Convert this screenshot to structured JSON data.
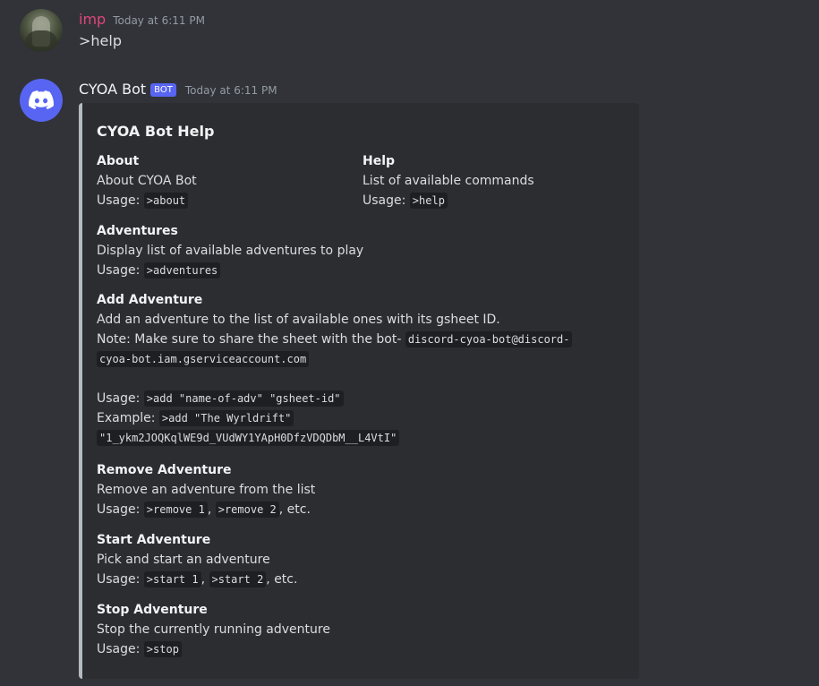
{
  "messages": {
    "user": {
      "username": "imp",
      "timestamp": "Today at 6:11 PM",
      "text": ">help"
    },
    "bot": {
      "username": "CYOA Bot",
      "tag": "BOT",
      "timestamp": "Today at 6:11 PM"
    }
  },
  "embed": {
    "title": "CYOA Bot Help",
    "accent_color": "#b5bac1",
    "fields": {
      "about": {
        "name": "About",
        "desc": "About CYOA Bot",
        "usage_label": "Usage: ",
        "usage_code": ">about"
      },
      "help": {
        "name": "Help",
        "desc": "List of available commands",
        "usage_label": "Usage: ",
        "usage_code": ">help"
      },
      "adventures": {
        "name": "Adventures",
        "desc": "Display list of available adventures to play",
        "usage_label": "Usage: ",
        "usage_code": ">adventures"
      },
      "add_adventure": {
        "name": "Add Adventure",
        "desc": "Add an adventure to the list of available ones with its gsheet ID.",
        "note_label": "Note: Make sure to share the sheet with the bot- ",
        "note_code_1": "discord-cyoa-bot@discord-",
        "note_code_2": "cyoa-bot.iam.gserviceaccount.com",
        "usage_label": "Usage: ",
        "usage_code": ">add \"name-of-adv\" \"gsheet-id\"",
        "example_label": "Example: ",
        "example_code_1": ">add \"The Wyrldrift\"",
        "example_code_2": "\"1_ykm2JOQKqlWE9d_VUdWY1YApH0DfzVDQDbM__L4VtI\""
      },
      "remove_adventure": {
        "name": "Remove Adventure",
        "desc": "Remove an adventure from the list",
        "usage_label": "Usage: ",
        "usage_code_1": ">remove 1",
        "sep": ", ",
        "usage_code_2": ">remove 2",
        "suffix": ", etc."
      },
      "start_adventure": {
        "name": "Start Adventure",
        "desc": "Pick and start an adventure",
        "usage_label": "Usage: ",
        "usage_code_1": ">start 1",
        "sep": ", ",
        "usage_code_2": ">start 2",
        "suffix": ", etc."
      },
      "stop_adventure": {
        "name": "Stop Adventure",
        "desc": "Stop the currently running adventure",
        "usage_label": "Usage: ",
        "usage_code": ">stop"
      }
    }
  },
  "icons": {
    "bot_avatar": "discord-logo-icon",
    "user_avatar": "hooded-figure-avatar"
  },
  "colors": {
    "background": "#313338",
    "embed_background": "#2b2d31",
    "user_name": "#e0467a",
    "bot_tag": "#5865f2"
  }
}
